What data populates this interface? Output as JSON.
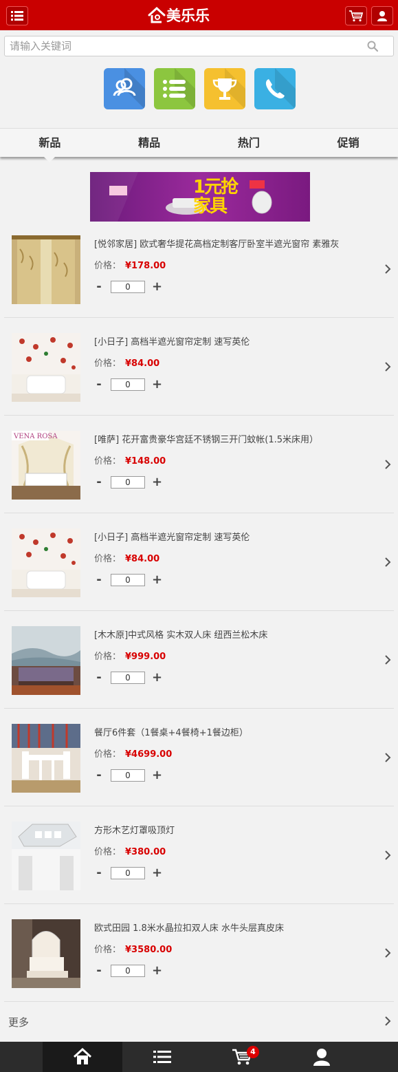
{
  "header": {
    "logo_text": "美乐乐",
    "menu_icon": "menu-icon",
    "cart_icon": "cart-icon",
    "user_icon": "user-icon",
    "brand_color": "#c90000"
  },
  "search": {
    "placeholder": "请输入关键词",
    "value": "",
    "icon": "search-icon"
  },
  "quick_links": [
    {
      "icon": "users-icon",
      "color": "#4a90e2"
    },
    {
      "icon": "list-icon",
      "color": "#8cc63f"
    },
    {
      "icon": "trophy-icon",
      "color": "#f5c02f"
    },
    {
      "icon": "phone-icon",
      "color": "#3ab0e3"
    }
  ],
  "tabs": [
    {
      "label": "新品",
      "active": true
    },
    {
      "label": "精品",
      "active": false
    },
    {
      "label": "热门",
      "active": false
    },
    {
      "label": "促销",
      "active": false
    }
  ],
  "banner": {
    "title": "1元抢家具"
  },
  "price_label": "价格：",
  "products": [
    {
      "name": "[悦邻家居] 欧式奢华提花高档定制客厅卧室半遮光窗帘 素雅灰",
      "price": "¥178.00",
      "qty": "0"
    },
    {
      "name": "[小日子] 高档半遮光窗帘定制 速写英伦",
      "price": "¥84.00",
      "qty": "0"
    },
    {
      "name": "[唯萨] 花开富贵豪华宫廷不锈钢三开门蚊帐(1.5米床用）",
      "price": "¥148.00",
      "qty": "0"
    },
    {
      "name": "[小日子] 高档半遮光窗帘定制 速写英伦",
      "price": "¥84.00",
      "qty": "0"
    },
    {
      "name": "[木木原]中式风格 实木双人床 纽西兰松木床",
      "price": "¥999.00",
      "qty": "0"
    },
    {
      "name": "餐厅6件套（1餐桌+4餐椅+1餐边柜）",
      "price": "¥4699.00",
      "qty": "0"
    },
    {
      "name": "方形木艺灯罩吸顶灯",
      "price": "¥380.00",
      "qty": "0"
    },
    {
      "name": "欧式田园 1.8米水晶拉扣双人床 水牛头层真皮床",
      "price": "¥3580.00",
      "qty": "0"
    }
  ],
  "qty_minus": "-",
  "qty_plus": "+",
  "more_label": "更多",
  "bottom_nav": [
    {
      "icon": "home-icon"
    },
    {
      "icon": "list-icon"
    },
    {
      "icon": "cart-icon",
      "badge": "4"
    },
    {
      "icon": "user-icon"
    }
  ]
}
